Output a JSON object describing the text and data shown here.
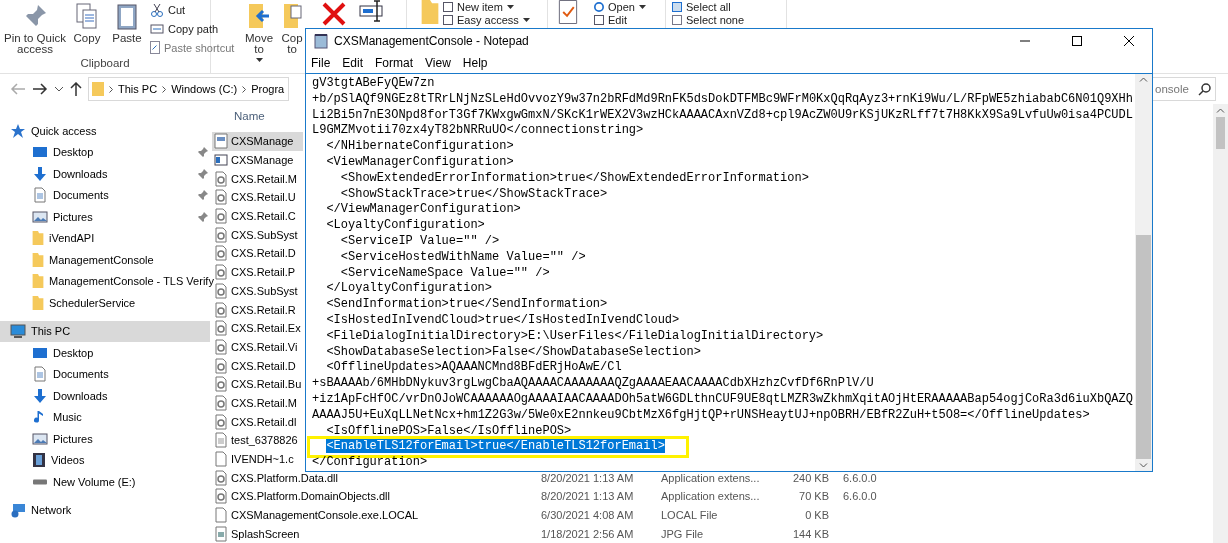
{
  "ribbon": {
    "clipboard": {
      "label": "Clipboard",
      "pin": "Pin to Quick access",
      "copy": "Copy",
      "paste": "Paste",
      "cut": "Cut",
      "copy_path": "Copy path",
      "paste_shortcut": "Paste shortcut"
    },
    "organize": {
      "move_to": "Move to",
      "copy_to": "Cop to"
    },
    "new": {
      "new_item": "New item",
      "easy_access": "Easy access"
    },
    "open": {
      "open": "Open",
      "edit": "Edit"
    },
    "select": {
      "select_all": "Select all",
      "select_none": "Select none"
    }
  },
  "address": {
    "crumbs": [
      "This PC",
      "Windows (C:)",
      "Progra"
    ],
    "search_placeholder": "onsole"
  },
  "nav": [
    {
      "label": "Quick access",
      "kind": "star",
      "selected": false,
      "children": [
        {
          "label": "Desktop",
          "kind": "desktop",
          "pinned": true,
          "selected": false
        },
        {
          "label": "Downloads",
          "kind": "download",
          "pinned": true,
          "selected": false
        },
        {
          "label": "Documents",
          "kind": "document",
          "pinned": true,
          "selected": false
        },
        {
          "label": "Pictures",
          "kind": "picture",
          "pinned": true,
          "selected": false
        },
        {
          "label": "iVendAPI",
          "kind": "folder",
          "pinned": false,
          "selected": false
        },
        {
          "label": "ManagementConsole",
          "kind": "folder",
          "pinned": false,
          "selected": false
        },
        {
          "label": "ManagementConsole - TLS Verify",
          "kind": "folder",
          "pinned": false,
          "selected": false
        },
        {
          "label": "SchedulerService",
          "kind": "folder",
          "pinned": false,
          "selected": false
        }
      ]
    },
    {
      "label": "This PC",
      "kind": "computer",
      "selected": true,
      "children": [
        {
          "label": "Desktop",
          "kind": "desktop",
          "pinned": false,
          "selected": false
        },
        {
          "label": "Documents",
          "kind": "document",
          "pinned": false,
          "selected": false
        },
        {
          "label": "Downloads",
          "kind": "download",
          "pinned": false,
          "selected": false
        },
        {
          "label": "Music",
          "kind": "music",
          "pinned": false,
          "selected": false
        },
        {
          "label": "Pictures",
          "kind": "picture",
          "pinned": false,
          "selected": false
        },
        {
          "label": "Videos",
          "kind": "video",
          "pinned": false,
          "selected": false
        },
        {
          "label": "New Volume (E:)",
          "kind": "drive",
          "pinned": false,
          "selected": false
        }
      ]
    },
    {
      "label": "Network",
      "kind": "network",
      "selected": false
    }
  ],
  "files": {
    "header": "Name",
    "rows": [
      {
        "name": "CXSManage",
        "kind": "config",
        "selected": true
      },
      {
        "name": "CXSManage",
        "kind": "app",
        "selected": false
      },
      {
        "name": "CXS.Retail.M",
        "kind": "dll",
        "selected": false
      },
      {
        "name": "CXS.Retail.U",
        "kind": "dll",
        "selected": false
      },
      {
        "name": "CXS.Retail.C",
        "kind": "dll",
        "selected": false
      },
      {
        "name": "CXS.SubSyst",
        "kind": "dll",
        "selected": false
      },
      {
        "name": "CXS.Retail.D",
        "kind": "dll",
        "selected": false
      },
      {
        "name": "CXS.Retail.P",
        "kind": "dll",
        "selected": false
      },
      {
        "name": "CXS.SubSyst",
        "kind": "dll",
        "selected": false
      },
      {
        "name": "CXS.Retail.R",
        "kind": "dll",
        "selected": false
      },
      {
        "name": "CXS.Retail.Ex",
        "kind": "dll",
        "selected": false
      },
      {
        "name": "CXS.Retail.Vi",
        "kind": "dll",
        "selected": false
      },
      {
        "name": "CXS.Retail.D",
        "kind": "dll",
        "selected": false
      },
      {
        "name": "CXS.Retail.Bu",
        "kind": "dll",
        "selected": false
      },
      {
        "name": "CXS.Retail.M",
        "kind": "dll",
        "selected": false
      },
      {
        "name": "CXS.Retail.dl",
        "kind": "dll",
        "selected": false
      },
      {
        "name": "test_6378826",
        "kind": "text",
        "selected": false
      },
      {
        "name": "IVENDH~1.c",
        "kind": "blank",
        "selected": false
      },
      {
        "name": "CXS.Platform.Data.dll",
        "kind": "dll",
        "selected": false,
        "date": "8/20/2021 1:13 AM",
        "type": "Application extens...",
        "size": "240 KB",
        "version": "6.6.0.0"
      },
      {
        "name": "CXS.Platform.DomainObjects.dll",
        "kind": "dll",
        "selected": false,
        "date": "8/20/2021 1:13 AM",
        "type": "Application extens...",
        "size": "70 KB",
        "version": "6.6.0.0"
      },
      {
        "name": "CXSManagementConsole.exe.LOCAL",
        "kind": "blank",
        "selected": false,
        "date": "6/30/2021 4:08 AM",
        "type": "LOCAL File",
        "size": "0 KB"
      },
      {
        "name": "SplashScreen",
        "kind": "image",
        "selected": false,
        "date": "1/18/2021 2:56 AM",
        "type": "JPG File",
        "size": "144 KB"
      }
    ]
  },
  "notepad": {
    "title": "CXSManagementConsole - Notepad",
    "menu": [
      "File",
      "Edit",
      "Format",
      "View",
      "Help"
    ],
    "lines": [
      {
        "text": "gV3tgtABeFyQEw7zn",
        "selected": false,
        "boxed": false
      },
      {
        "text": "+b/pSlAQf9NGEz8tTRrLNjNzSLeHdOvvozY9w37n2bRFdMd9RnFK5dsDokDTFMBc9WFrM0KxQqRqAyz3+rnKi9Wu/L/RFpWE5zhiababC6N01Q9XHh",
        "selected": false,
        "boxed": false
      },
      {
        "text": "Li2Bi5n7nE3ONpd8forT3Gf7KWxgwGmxN/SKcK1rWEX2V3wzHCkAAAACAxnVZd8+cpl9AcZW0U9rKSjUKzRLff7t7H8KkX9Sa9LvfuUw0isa4PCUDL",
        "selected": false,
        "boxed": false
      },
      {
        "text": "L9GMZMvotii70zx4yT82bNRRuUO</connectionstring>",
        "selected": false,
        "boxed": false
      },
      {
        "text": "  </NHibernateConfiguration>",
        "selected": false,
        "boxed": false
      },
      {
        "text": "  <ViewManagerConfiguration>",
        "selected": false,
        "boxed": false
      },
      {
        "text": "    <ShowExtendedErrorInformation>true</ShowExtendedErrorInformation>",
        "selected": false,
        "boxed": false
      },
      {
        "text": "    <ShowStackTrace>true</ShowStackTrace>",
        "selected": false,
        "boxed": false
      },
      {
        "text": "  </ViewManagerConfiguration>",
        "selected": false,
        "boxed": false
      },
      {
        "text": "  <LoyaltyConfiguration>",
        "selected": false,
        "boxed": false
      },
      {
        "text": "    <ServiceIP Value=\"\" />",
        "selected": false,
        "boxed": false
      },
      {
        "text": "    <ServiceHostedWithName Value=\"\" />",
        "selected": false,
        "boxed": false
      },
      {
        "text": "    <ServiceNameSpace Value=\"\" />",
        "selected": false,
        "boxed": false
      },
      {
        "text": "  </LoyaltyConfiguration>",
        "selected": false,
        "boxed": false
      },
      {
        "text": "  <SendInformation>true</SendInformation>",
        "selected": false,
        "boxed": false
      },
      {
        "text": "  <IsHostedInIvendCloud>true</IsHostedInIvendCloud>",
        "selected": false,
        "boxed": false
      },
      {
        "text": "  <FileDialogInitialDirectory>E:\\UserFiles</FileDialogInitialDirectory>",
        "selected": false,
        "boxed": false
      },
      {
        "text": "  <ShowDatabaseSelection>False</ShowDatabaseSelection>",
        "selected": false,
        "boxed": false
      },
      {
        "text": "  <OfflineUpdates>AQAAANCMnd8BFdERjHoAwE/Cl",
        "selected": false,
        "boxed": false
      },
      {
        "text": "+sBAAAAb/6MHbDNykuv3rgLwgCbaAQAAAACAAAAAAAQZgAAAAEAACAAAACdbXHzhzCvfDf6RnPlV/U",
        "selected": false,
        "boxed": false
      },
      {
        "text": "+iz1ApFcHfOC/vrDnOJoWCAAAAAAOgAAAAIAACAAAADOh5atW6GDLthnCUF9UE8qtLMZR3wZkhmXqitAOjHtERAAAAABap54ogjCoRa3d6iuXbQAZQ",
        "selected": false,
        "boxed": false
      },
      {
        "text": "AAAAJ5U+EuXqLLNetNcx+hm1Z2G3w/5We0xE2nnkeu9CbtMzX6fgHjtQP+rUNSHeaytUJ+npOBRH/EBfR2ZuH+t5O8=</OfflineUpdates>",
        "selected": false,
        "boxed": false
      },
      {
        "text": "  <IsOfflinePOS>False</IsOfflinePOS>",
        "selected": false,
        "boxed": false
      },
      {
        "text": "  <EnableTLS12forEmail>true</EnableTLS12forEmail>",
        "selected": true,
        "boxed": true
      },
      {
        "text": "</Configuration>",
        "selected": false,
        "boxed": false
      }
    ]
  }
}
